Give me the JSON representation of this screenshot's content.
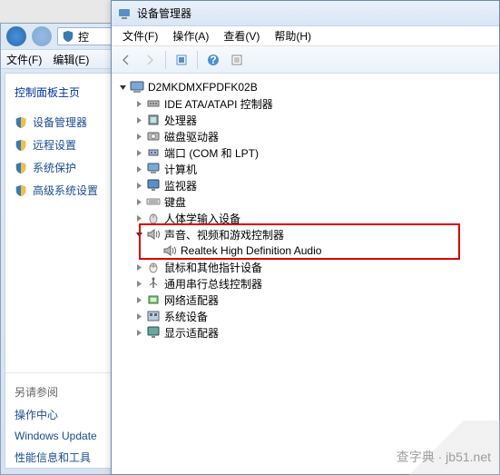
{
  "bgWindow": {
    "addr_hint": "控",
    "menu": {
      "file": "文件(F)",
      "edit": "编辑(E)"
    },
    "sidebar": {
      "header": "控制面板主页",
      "items": [
        {
          "label": "设备管理器"
        },
        {
          "label": "远程设置"
        },
        {
          "label": "系统保护"
        },
        {
          "label": "高级系统设置"
        }
      ],
      "seeAlsoHeader": "另请参阅",
      "seeAlso": [
        "操作中心",
        "Windows Update",
        "性能信息和工具"
      ]
    }
  },
  "mainWindow": {
    "title": "设备管理器",
    "menu": {
      "file": "文件(F)",
      "action": "操作(A)",
      "view": "查看(V)",
      "help": "帮助(H)"
    },
    "tree": {
      "root": "D2MKDMXFPDFK02B",
      "nodes": [
        {
          "label": "IDE ATA/ATAPI 控制器",
          "icon": "ide",
          "expandable": true
        },
        {
          "label": "处理器",
          "icon": "cpu",
          "expandable": true
        },
        {
          "label": "磁盘驱动器",
          "icon": "disk",
          "expandable": true
        },
        {
          "label": "端口 (COM 和 LPT)",
          "icon": "port",
          "expandable": true
        },
        {
          "label": "计算机",
          "icon": "computer",
          "expandable": true
        },
        {
          "label": "监视器",
          "icon": "monitor",
          "expandable": true
        },
        {
          "label": "键盘",
          "icon": "keyboard",
          "expandable": true
        },
        {
          "label": "人体学输入设备",
          "icon": "hid",
          "expandable": true
        },
        {
          "label": "声音、视频和游戏控制器",
          "icon": "sound",
          "expandable": true,
          "expanded": true,
          "children": [
            {
              "label": "Realtek High Definition Audio",
              "icon": "sound"
            }
          ]
        },
        {
          "label": "鼠标和其他指针设备",
          "icon": "mouse",
          "expandable": true
        },
        {
          "label": "通用串行总线控制器",
          "icon": "usb",
          "expandable": true
        },
        {
          "label": "网络适配器",
          "icon": "network",
          "expandable": true
        },
        {
          "label": "系统设备",
          "icon": "system",
          "expandable": true
        },
        {
          "label": "显示适配器",
          "icon": "display",
          "expandable": true
        }
      ]
    }
  },
  "watermark": "查字典 · jb51.net"
}
